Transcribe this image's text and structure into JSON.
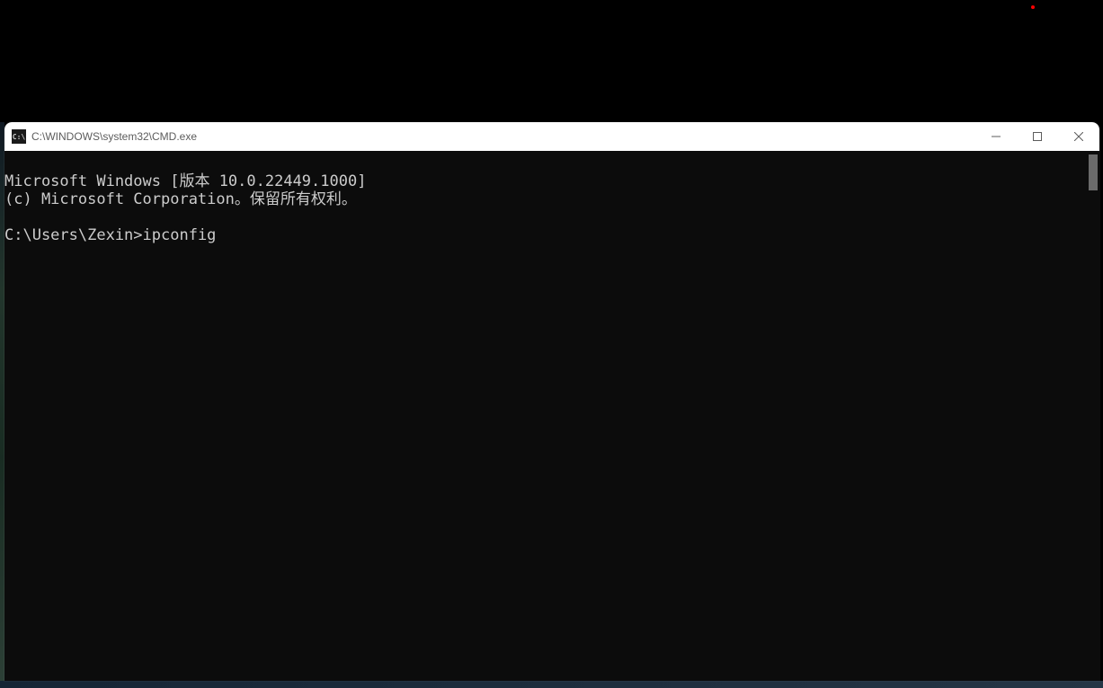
{
  "window": {
    "title": "C:\\WINDOWS\\system32\\CMD.exe",
    "icon_label": "C:\\"
  },
  "terminal": {
    "line1": "Microsoft Windows [版本 10.0.22449.1000]",
    "line2": "(c) Microsoft Corporation。保留所有权利。",
    "blank": "",
    "prompt": "C:\\Users\\Zexin>",
    "command": "ipconfig"
  }
}
